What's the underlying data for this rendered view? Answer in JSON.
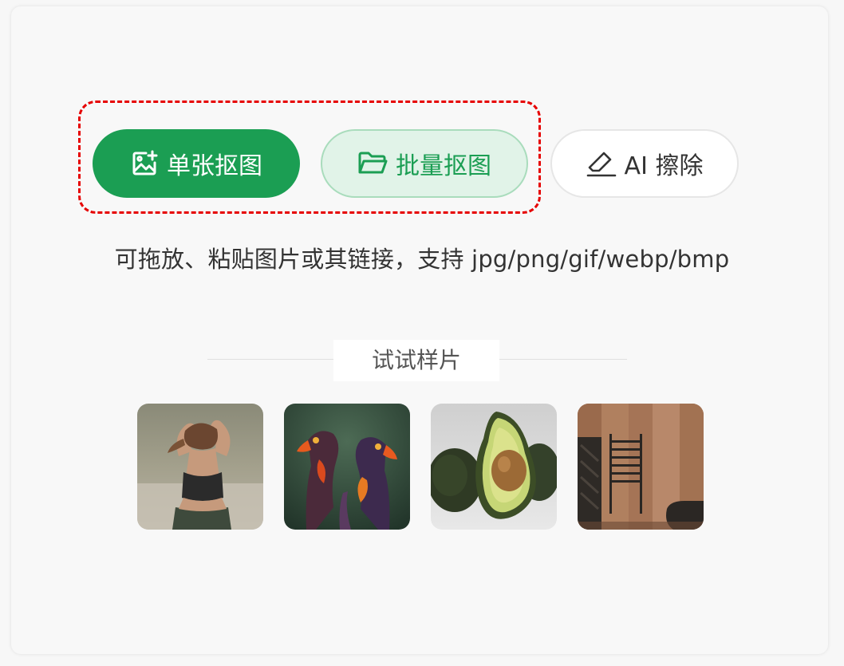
{
  "upload": {
    "single_label": "单张抠图",
    "batch_label": "批量抠图",
    "erase_label": "AI 擦除",
    "hint": "可拖放、粘贴图片或其链接，支持 jpg/png/gif/webp/bmp"
  },
  "samples": {
    "title": "试试样片",
    "items": [
      {
        "subject": "woman-athlete"
      },
      {
        "subject": "parrots"
      },
      {
        "subject": "avocado"
      },
      {
        "subject": "bathroom-interior"
      }
    ]
  },
  "colors": {
    "primary": "#1b9e53",
    "primary_light": "#e1f3e8",
    "highlight": "#e60000"
  },
  "icons": {
    "single": "image-add-icon",
    "batch": "folder-icon",
    "erase": "eraser-icon"
  }
}
